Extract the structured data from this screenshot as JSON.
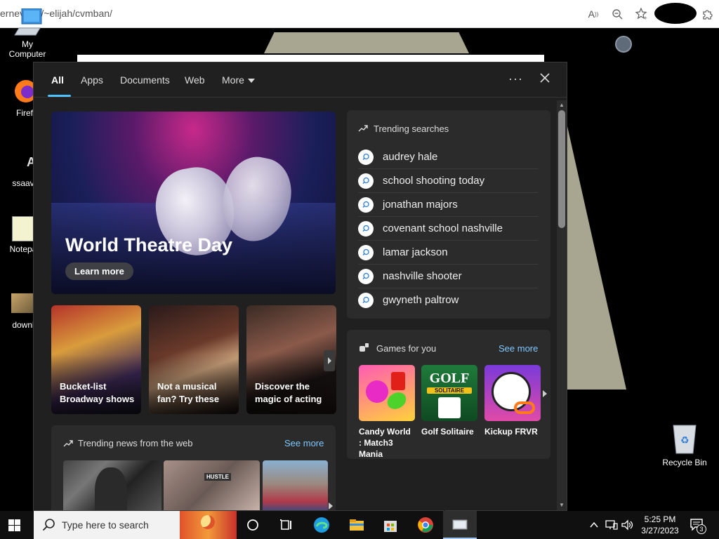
{
  "browser": {
    "url": "ernev      om/~elijah/cvmban/"
  },
  "desktop": {
    "icons": [
      {
        "label": "My Computer"
      },
      {
        "label": "Firef"
      },
      {
        "label": "ssaav"
      },
      {
        "label": "Notepa"
      },
      {
        "label": "downl"
      }
    ],
    "recycle_bin": "Recycle Bin"
  },
  "search_flyout": {
    "tabs": [
      {
        "label": "All",
        "active": true
      },
      {
        "label": "Apps"
      },
      {
        "label": "Documents"
      },
      {
        "label": "Web"
      },
      {
        "label": "More"
      }
    ],
    "more_options": "···",
    "hero": {
      "title": "World Theatre Day",
      "button": "Learn more"
    },
    "stories": [
      {
        "caption": "Bucket-list Broadway shows"
      },
      {
        "caption": "Not a musical fan? Try these"
      },
      {
        "caption": "Discover the magic of acting"
      }
    ],
    "trending_searches": {
      "title": "Trending searches",
      "items": [
        "audrey hale",
        "school shooting today",
        "jonathan majors",
        "covenant school nashville",
        "lamar jackson",
        "nashville shooter",
        "gwyneth paltrow"
      ]
    },
    "games": {
      "title": "Games for you",
      "see_more": "See more",
      "items": [
        {
          "name": "Candy World : Match3 Mania"
        },
        {
          "name": "Golf Solitaire",
          "tile_text": "GOLF",
          "tile_sub": "SOLITAIRE"
        },
        {
          "name": "Kickup FRVR"
        }
      ]
    },
    "trending_news": {
      "title": "Trending news from the web",
      "see_more": "See more",
      "thumb_text": "HUSTLE"
    }
  },
  "taskbar": {
    "search_placeholder": "Type here to search",
    "time": "5:25 PM",
    "date": "3/27/2023",
    "notification_count": "3"
  },
  "colors": {
    "accent": "#4cc2ff",
    "link": "#7fc8ff",
    "flyout_bg": "#202020",
    "card_bg": "#2b2b2b"
  }
}
